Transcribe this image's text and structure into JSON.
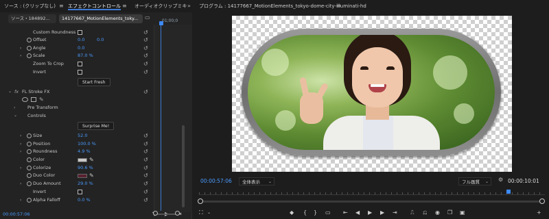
{
  "header": {
    "tab_source": "ソース : (クリップなし)",
    "tab_effect_controls": "エフェクトコントロール",
    "tab_audio_mixer": "オーディオクリップミキ",
    "tab_program": "プログラム : 14177667_MotionElements_tokyo-dome-city-illuminati-hd",
    "menu_glyph": "≡",
    "more_glyph": "»"
  },
  "effect_controls": {
    "source_clip_tab": "ソース・184892...",
    "sequence_clip_tab": "14177667_MotionElements_toky...",
    "timeline_time": "01;00;0",
    "rows": {
      "custom_roundness": "Custom Roundness",
      "offset": "Offset",
      "offset_value_x": "0.0",
      "offset_value_y": "0.0",
      "angle": "Angle",
      "angle_value": "0.0",
      "scale": "Scale",
      "scale_value": "87.0 %",
      "zoom_to_crop": "Zoom To Crop",
      "invert": "Invert",
      "start_fresh_button": "Start Fresh",
      "fx_prefix": "fx",
      "stroke_fx": "FL Stroke FX",
      "pre_transform": "Pre Transform",
      "controls": "Controls",
      "surprise_button": "Surprise Me!",
      "size": "Size",
      "size_value": "52.0",
      "position": "Position",
      "position_value": "100.0 %",
      "roundness": "Roundness",
      "roundness_value": "4.9 %",
      "color": "Color",
      "colorize": "Colorize",
      "colorize_value": "90.6 %",
      "duo_color": "Duo Color",
      "duo_amount": "Duo Amount",
      "duo_amount_value": "29.0 %",
      "invert2": "Invert",
      "alpha_falloff": "Alpha Falloff",
      "alpha_falloff_value": "0.0 %"
    },
    "current_time": "00:00:57:06",
    "colors": {
      "color_swatch": "#c8c8c8",
      "duo_swatch": "#5a2030"
    }
  },
  "program_monitor": {
    "current_time": "00:00:57:06",
    "fit_select": "全体表示",
    "quality_select": "フル画質",
    "duration": "00:00:10:01"
  },
  "icons": {
    "reset": "↺",
    "chevron_right": "›",
    "chevron_down": "⌄",
    "eyedropper": "✎",
    "filter": "▼",
    "play": "▶",
    "step_back": "◀",
    "step_forward": "▶",
    "go_in": "⇤",
    "go_out": "⇥",
    "marker": "◆",
    "in_point": "{",
    "out_point": "}",
    "lift": "⎍",
    "extract": "⎌",
    "camera": "◉",
    "compare": "❐",
    "add": "+",
    "wrench": "🔧",
    "scale_tool": "⛶",
    "dropdown": "⌄"
  }
}
